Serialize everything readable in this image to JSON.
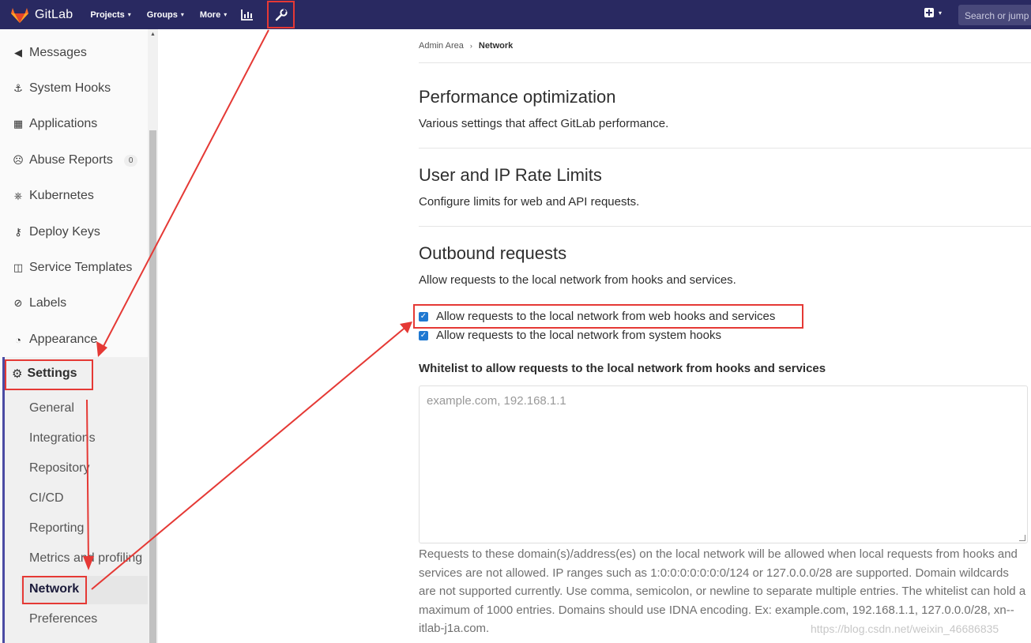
{
  "navbar": {
    "brand": "GitLab",
    "items": [
      {
        "label": "Projects",
        "chevron": "▾"
      },
      {
        "label": "Groups",
        "chevron": "▾"
      },
      {
        "label": "More",
        "chevron": "▾"
      }
    ],
    "icons": [
      "gitlab-logo-icon",
      "activity-chart-icon",
      "wrench-admin-icon",
      "plus-icon"
    ],
    "search_placeholder": "Search or jump to…"
  },
  "sidebar": {
    "items": [
      {
        "label": "Messages",
        "icon": "bullhorn-icon"
      },
      {
        "label": "System Hooks",
        "icon": "hook-icon"
      },
      {
        "label": "Applications",
        "icon": "applications-grid-icon"
      },
      {
        "label": "Abuse Reports",
        "icon": "abuse-face-icon",
        "badge": "0"
      },
      {
        "label": "Kubernetes",
        "icon": "kubernetes-icon"
      },
      {
        "label": "Deploy Keys",
        "icon": "key-icon"
      },
      {
        "label": "Service Templates",
        "icon": "template-icon"
      },
      {
        "label": "Labels",
        "icon": "label-tag-icon"
      },
      {
        "label": "Appearance",
        "icon": "palette-icon"
      }
    ],
    "settings": {
      "label": "Settings",
      "icon": "gear-icon",
      "sub_items": [
        "General",
        "Integrations",
        "Repository",
        "CI/CD",
        "Reporting",
        "Metrics and profiling",
        "Network",
        "Preferences"
      ]
    }
  },
  "breadcrumb": {
    "parent": "Admin Area",
    "current": "Network"
  },
  "sections": [
    {
      "title": "Performance optimization",
      "description": "Various settings that affect GitLab performance."
    },
    {
      "title": "User and IP Rate Limits",
      "description": "Configure limits for web and API requests."
    },
    {
      "title": "Outbound requests",
      "description": "Allow requests to the local network from hooks and services."
    }
  ],
  "outbound": {
    "checkboxes": [
      {
        "label": "Allow requests to the local network from web hooks and services",
        "checked": true
      },
      {
        "label": "Allow requests to the local network from system hooks",
        "checked": true
      }
    ],
    "whitelist_label": "Whitelist to allow requests to the local network from hooks and services",
    "whitelist_placeholder": "example.com, 192.168.1.1",
    "help_text": "Requests to these domain(s)/address(es) on the local network will be allowed when local requests from hooks and services are not allowed. IP ranges such as 1:0:0:0:0:0:0:0/124 or 127.0.0.0/28 are supported. Domain wildcards are not supported currently. Use comma, semicolon, or newline to separate multiple entries. The whitelist can hold a maximum of 1000 entries. Domains should use IDNA encoding. Ex: example.com, 192.168.1.1, 127.0.0.0/28, xn--itlab-j1a.com."
  },
  "watermark": "https://blog.csdn.net/weixin_46686835",
  "colors": {
    "navbar": "#292961",
    "annotation": "#e53935",
    "checkbox": "#1f78d1",
    "brand_logo": "#fc6d26"
  }
}
